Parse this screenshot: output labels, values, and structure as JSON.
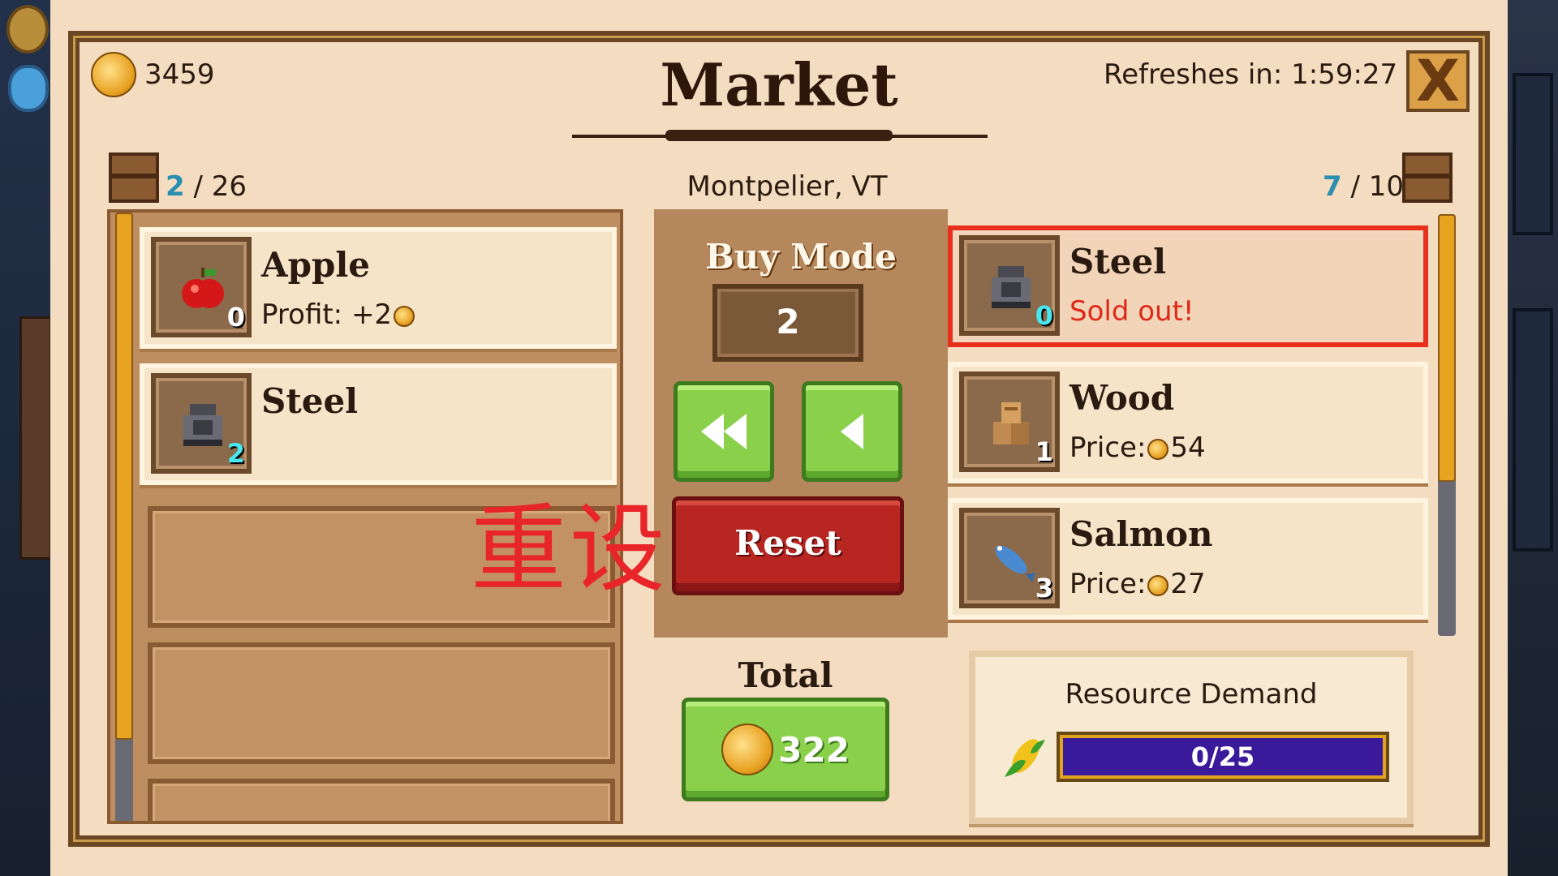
{
  "header": {
    "title": "Market",
    "gold": "3459",
    "refresh_label": "Refreshes in: 1:59:27",
    "close_label": "X",
    "location": "Montpelier, VT"
  },
  "inventory": {
    "count_current": "2",
    "count_total": "/ 26",
    "items": [
      {
        "name": "Apple",
        "qty": "0",
        "sub_label": "Profit: +2",
        "icon": "apple-icon"
      },
      {
        "name": "Steel",
        "qty": "2",
        "sub_label": "",
        "icon": "steel-icon"
      }
    ],
    "empty_slots": 3
  },
  "trade": {
    "mode_label": "Buy Mode",
    "quantity": "2",
    "fast_back_icon": "double-left-arrow-icon",
    "back_icon": "left-arrow-icon",
    "reset_label": "Reset",
    "overlay_text": "重设",
    "total_label": "Total",
    "total_value": "322"
  },
  "market": {
    "count_current": "7",
    "count_total": "/ 10",
    "items": [
      {
        "name": "Steel",
        "qty": "0",
        "sub_label": "Sold out!",
        "icon": "steel-icon",
        "sold_out": true
      },
      {
        "name": "Wood",
        "qty": "1",
        "sub_label": "Price:",
        "price": "54",
        "icon": "wood-icon"
      },
      {
        "name": "Salmon",
        "qty": "3",
        "sub_label": "Price:",
        "price": "27",
        "icon": "salmon-icon"
      }
    ]
  },
  "demand": {
    "title": "Resource Demand",
    "icon": "corn-icon",
    "progress_text": "0/25",
    "progress_fraction": 0
  },
  "colors": {
    "panel_bg": "#f4dcc0",
    "accent_green": "#8ad04a",
    "reset_red": "#b82622",
    "bar_purple": "#3a1a9a",
    "highlight_cyan": "#2a8fb0"
  }
}
